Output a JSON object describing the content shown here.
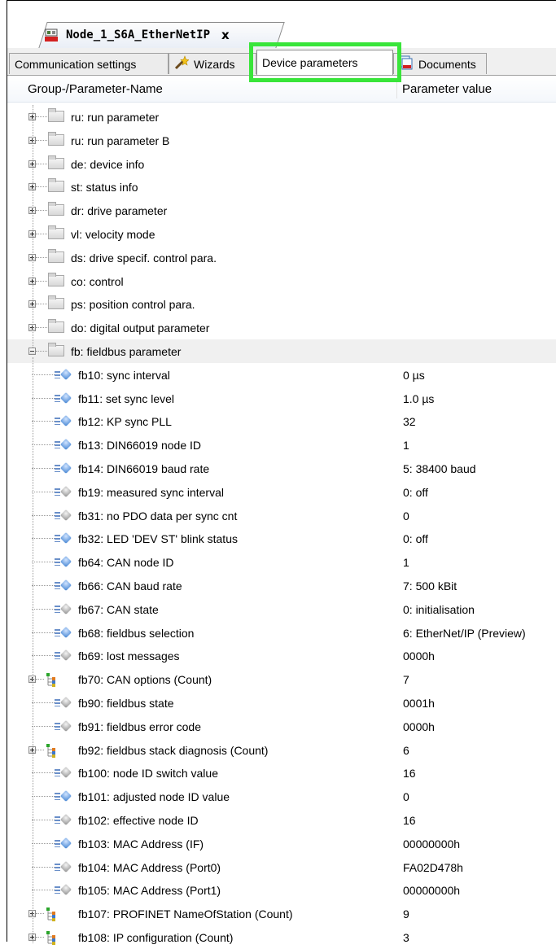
{
  "document_tab": {
    "title": "Node_1_S6A_EtherNetIP",
    "close_label": "x"
  },
  "tabs": [
    {
      "label": "Communication settings",
      "icon": "none",
      "active": false
    },
    {
      "label": "Wizards",
      "icon": "wand-icon",
      "active": false
    },
    {
      "label": "Device parameters",
      "icon": "none",
      "active": true
    },
    {
      "label": "Documents",
      "icon": "documents-icon",
      "active": false
    }
  ],
  "columns": {
    "name": "Group-/Parameter-Name",
    "value": "Parameter value"
  },
  "groups": [
    {
      "name": "ru: run parameter"
    },
    {
      "name": "ru: run parameter B"
    },
    {
      "name": "de: device info"
    },
    {
      "name": "st: status info"
    },
    {
      "name": "dr: drive parameter"
    },
    {
      "name": "vl: velocity mode"
    },
    {
      "name": "ds: drive specif. control para."
    },
    {
      "name": "co: control"
    },
    {
      "name": "ps: position control para."
    },
    {
      "name": "do: digital output parameter"
    },
    {
      "name": "fb: fieldbus parameter"
    }
  ],
  "fb_params": [
    {
      "name": "fb10: sync interval",
      "value": "0 µs",
      "kind": "blue"
    },
    {
      "name": "fb11: set sync level",
      "value": "1.0 µs",
      "kind": "blue"
    },
    {
      "name": "fb12: KP sync PLL",
      "value": "32",
      "kind": "blue"
    },
    {
      "name": "fb13: DIN66019 node ID",
      "value": "1",
      "kind": "blue"
    },
    {
      "name": "fb14: DIN66019 baud rate",
      "value": "5: 38400 baud",
      "kind": "blue"
    },
    {
      "name": "fb19: measured sync interval",
      "value": "0: off",
      "kind": "grey"
    },
    {
      "name": "fb31: no PDO data per sync cnt",
      "value": "0",
      "kind": "grey"
    },
    {
      "name": "fb32: LED 'DEV ST' blink status",
      "value": "0: off",
      "kind": "blue"
    },
    {
      "name": "fb64: CAN node ID",
      "value": "1",
      "kind": "blue"
    },
    {
      "name": "fb66: CAN baud rate",
      "value": "7: 500 kBit",
      "kind": "blue"
    },
    {
      "name": "fb67: CAN state",
      "value": "0: initialisation",
      "kind": "grey"
    },
    {
      "name": "fb68: fieldbus selection",
      "value": "6: EtherNet/IP (Preview)",
      "kind": "blue"
    },
    {
      "name": "fb69: lost messages",
      "value": "0000h",
      "kind": "grey"
    },
    {
      "name": "fb70: CAN options (Count)",
      "value": "7",
      "kind": "group"
    },
    {
      "name": "fb90: fieldbus state",
      "value": "0001h",
      "kind": "grey"
    },
    {
      "name": "fb91: fieldbus error code",
      "value": "0000h",
      "kind": "grey"
    },
    {
      "name": "fb92: fieldbus stack diagnosis (Count)",
      "value": "6",
      "kind": "group"
    },
    {
      "name": "fb100: node ID switch value",
      "value": "16",
      "kind": "grey"
    },
    {
      "name": "fb101: adjusted node ID value",
      "value": "0",
      "kind": "blue"
    },
    {
      "name": "fb102: effective node ID",
      "value": "16",
      "kind": "grey"
    },
    {
      "name": "fb103: MAC Address (IF)",
      "value": "00000000h",
      "kind": "blue"
    },
    {
      "name": "fb104: MAC Address (Port0)",
      "value": "FA02D478h",
      "kind": "grey"
    },
    {
      "name": "fb105: MAC Address (Port1)",
      "value": "00000000h",
      "kind": "grey"
    },
    {
      "name": "fb107: PROFINET NameOfStation (Count)",
      "value": "9",
      "kind": "group"
    },
    {
      "name": "fb108: IP configuration (Count)",
      "value": "3",
      "kind": "group"
    }
  ],
  "colors": {
    "highlight": "#39e53a",
    "param_blue": "#3c7fd0",
    "param_grey": "#8d8d8d"
  }
}
